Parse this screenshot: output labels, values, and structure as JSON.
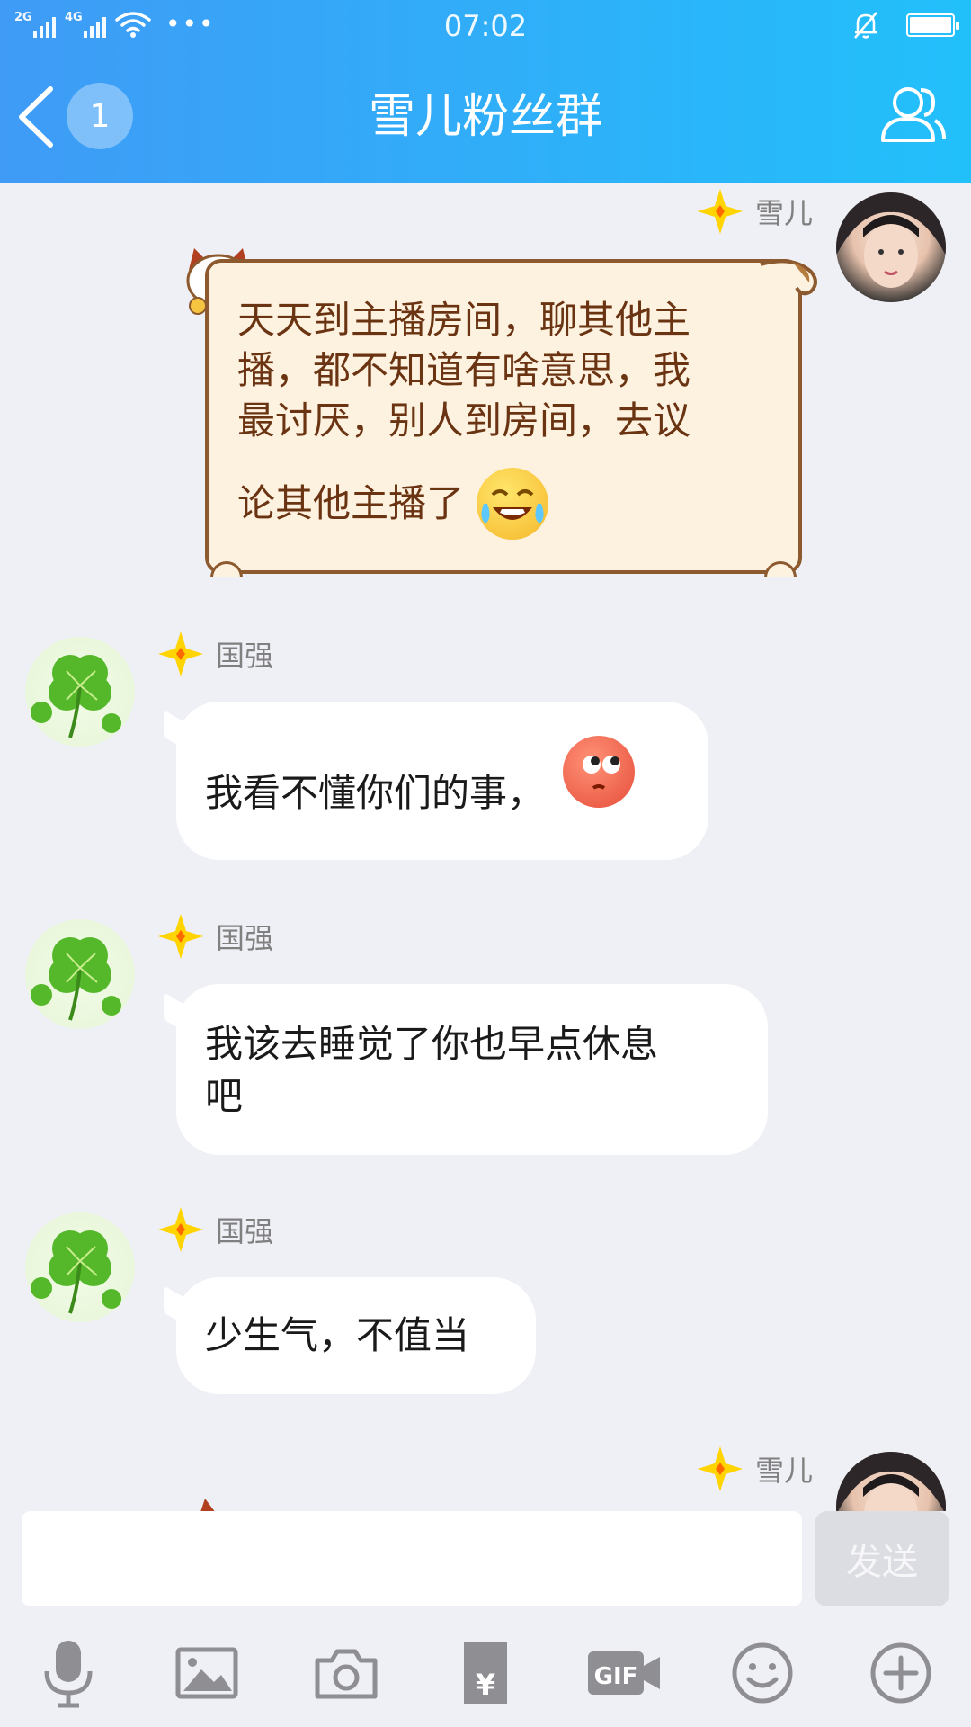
{
  "status_bar": {
    "sim1_net": "2G",
    "sim2_net": "4G",
    "dots": "•••",
    "time": "07:02",
    "battery_level": 1.0
  },
  "header": {
    "unread_count": "1",
    "title": "雪儿粉丝群",
    "members_icon": "members-icon"
  },
  "messages": [
    {
      "sender": "雪儿",
      "side": "right",
      "style": "scroll",
      "lines": [
        "天天到主播房间，聊其他主",
        "播，都不知道有啥意思，我",
        "最讨厌，别人到房间，去议",
        "论其他主播了"
      ],
      "emoji": "laughing-tears-icon"
    },
    {
      "sender": "国强",
      "side": "left",
      "text": "我看不懂你们的事，",
      "emoji": "embarrassed-face-icon"
    },
    {
      "sender": "国强",
      "side": "left",
      "lines": [
        "我该去睡觉了你也早点休息",
        "吧"
      ]
    },
    {
      "sender": "国强",
      "side": "left",
      "text": "少生气，不值当"
    },
    {
      "sender": "雪儿",
      "side": "right",
      "partial": true
    }
  ],
  "input": {
    "value": "",
    "placeholder": "",
    "send_label": "发送"
  },
  "toolbar": {
    "items": [
      "microphone-icon",
      "image-icon",
      "camera-icon",
      "red-packet-icon",
      "gif-icon",
      "emoji-icon",
      "plus-icon"
    ],
    "gif_label": "GIF",
    "yen_symbol": "¥"
  },
  "colors": {
    "header_start": "#3f9bf6",
    "header_end": "#22c0fb",
    "chat_bg": "#eff0f5",
    "scroll_text": "#6a3312",
    "badge_gold": "#ffd400"
  }
}
